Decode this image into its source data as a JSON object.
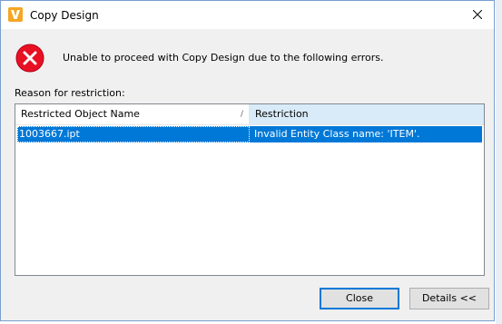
{
  "window": {
    "title": "Copy Design",
    "app_icon": "autodesk-vault-icon",
    "close_icon": "close-icon"
  },
  "message": {
    "icon": "error-icon",
    "text": "Unable to proceed with Copy Design due to the following errors."
  },
  "restrictions": {
    "label": "Reason for restriction:",
    "columns": [
      "Restricted Object Name",
      "Restriction"
    ],
    "rows": [
      {
        "object": "1003667.ipt",
        "restriction": "Invalid Entity Class name: 'ITEM'."
      }
    ]
  },
  "buttons": {
    "close_label": "Close",
    "details_label": "Details <<"
  },
  "colors": {
    "selection": "#0078d7",
    "header_highlight": "#d9ebf9",
    "error_red": "#e81123"
  }
}
